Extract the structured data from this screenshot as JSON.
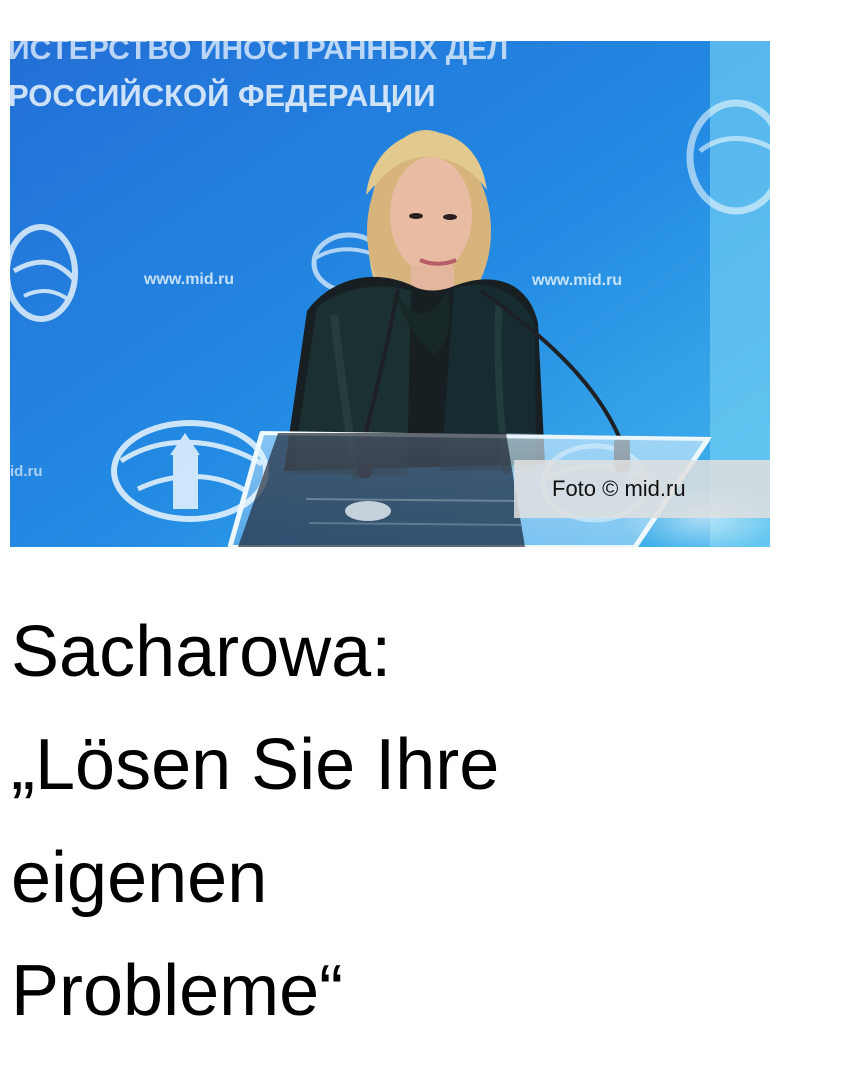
{
  "article": {
    "photo_backdrop_text": {
      "line1": "ИСТЕРСТВО ИНОСТРАННЫХ ДЕЛ",
      "line2": "РОССИЙСКОЙ ФЕДЕРАЦИИ",
      "website_left": "www.mid.ru",
      "website_right": "www.mid.ru",
      "website_edge": "id.ru"
    },
    "photo_credit": "Foto © mid.ru",
    "headline_lines": [
      "Sacharowa:",
      "„Lösen Sie Ihre",
      "eigenen",
      "Probleme“"
    ]
  },
  "colors": {
    "background": "#ffffff",
    "backdrop_blue": "#1f78d8",
    "headline_text": "#000000"
  }
}
